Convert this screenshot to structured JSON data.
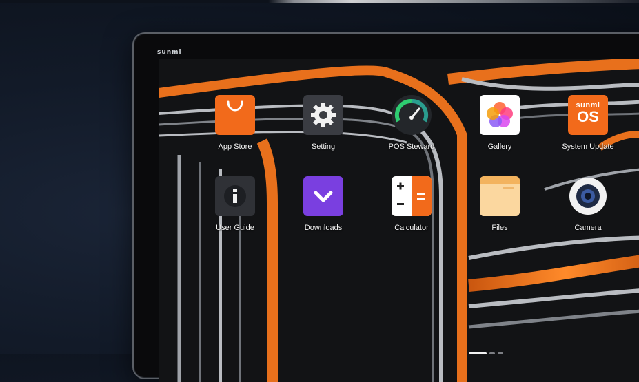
{
  "device": {
    "brand": "sunmi"
  },
  "apps": [
    {
      "label": "App Store",
      "icon": "shopping-bag-icon"
    },
    {
      "label": "Setting",
      "icon": "gear-icon"
    },
    {
      "label": "POS Steward",
      "icon": "speedometer-icon"
    },
    {
      "label": "Gallery",
      "icon": "petals-icon"
    },
    {
      "label": "System Update",
      "icon": "sunmi-os-icon",
      "icon_text_top": "sunmi",
      "icon_text_bottom": "OS"
    },
    {
      "label": "User Guide",
      "icon": "info-icon"
    },
    {
      "label": "Downloads",
      "icon": "chevron-down-icon"
    },
    {
      "label": "Calculator",
      "icon": "calculator-icon"
    },
    {
      "label": "Files",
      "icon": "folder-icon"
    },
    {
      "label": "Camera",
      "icon": "camera-lens-icon"
    }
  ],
  "pager": {
    "pages": 3,
    "current": 1
  },
  "colors": {
    "accent_orange": "#f07a1e",
    "wallpaper_dark": "#111214",
    "silver": "#c9ccd1"
  }
}
